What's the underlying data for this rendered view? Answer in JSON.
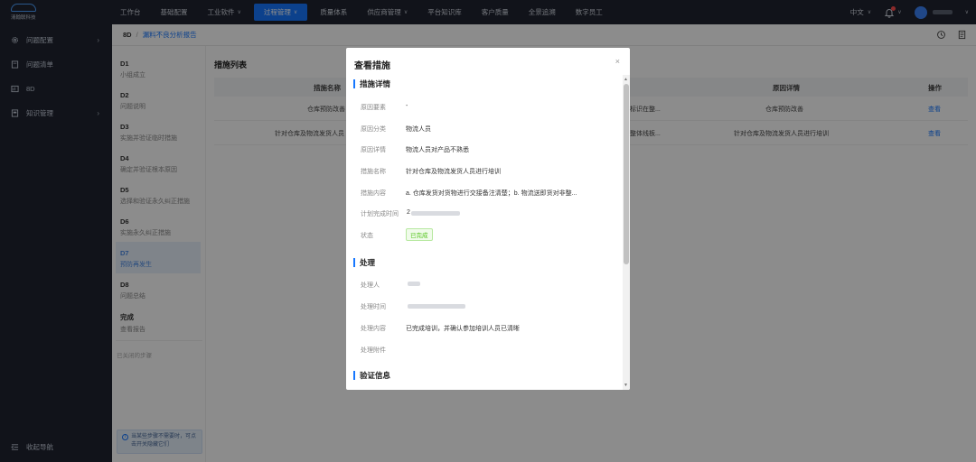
{
  "brand": {
    "name": "清翰联科技"
  },
  "topnav": {
    "items": [
      {
        "label": "工作台"
      },
      {
        "label": "基础配置"
      },
      {
        "label": "工业软件",
        "chevron": true
      },
      {
        "label": "过程管理",
        "chevron": true,
        "active": true
      },
      {
        "label": "质量体系"
      },
      {
        "label": "供应商管理",
        "chevron": true
      },
      {
        "label": "平台知识库"
      },
      {
        "label": "客户质量"
      },
      {
        "label": "全景追溯"
      },
      {
        "label": "数字员工"
      }
    ],
    "language": "中文"
  },
  "sidebar": {
    "items": [
      {
        "label": "问题配置",
        "icon": "gear-icon",
        "expandable": true
      },
      {
        "label": "问题清单",
        "icon": "list-icon",
        "expandable": false
      },
      {
        "label": "8D",
        "icon": "report-icon",
        "expandable": false
      },
      {
        "label": "知识管理",
        "icon": "book-icon",
        "expandable": true
      }
    ],
    "collapse_label": "收起导航"
  },
  "breadcrumb": {
    "root": "8D",
    "separator": "/",
    "current": "漏料不良分析报告"
  },
  "steps": {
    "items": [
      {
        "code": "D1",
        "desc": "小组成立"
      },
      {
        "code": "D2",
        "desc": "问题说明"
      },
      {
        "code": "D3",
        "desc": "实施并验证临时措施"
      },
      {
        "code": "D4",
        "desc": "确定并验证根本原因"
      },
      {
        "code": "D5",
        "desc": "选择和验证永久纠正措施"
      },
      {
        "code": "D6",
        "desc": "实施永久纠正措施"
      },
      {
        "code": "D7",
        "desc": "预防再发生",
        "active": true
      },
      {
        "code": "D8",
        "desc": "问题总结"
      },
      {
        "code": "完成",
        "desc": "查看报告"
      }
    ],
    "closed_label": "已关闭的步骤",
    "tip": "当某些步骤不需要时，可点击开关隐藏它们"
  },
  "measures": {
    "title": "措施列表",
    "columns": {
      "name": "措施名称",
      "reason": "原因详情",
      "action": "操作"
    },
    "rows": [
      {
        "name": "仓库预防改善",
        "mid": "标识在整...",
        "reason": "仓库预防改善",
        "action": "查看"
      },
      {
        "name": "针对仓库及物流发货人员",
        "mid": "整体线板...",
        "reason": "针对仓库及物流发货人员进行培训",
        "action": "查看"
      }
    ]
  },
  "modal": {
    "title": "查看措施",
    "close": "×",
    "detail": {
      "title": "措施详情",
      "fields": [
        {
          "label": "原因要素",
          "value": "-"
        },
        {
          "label": "原因分类",
          "value": "物流人员"
        },
        {
          "label": "原因详情",
          "value": "物流人员对产品不熟悉"
        },
        {
          "label": "措施名称",
          "value": "针对仓库及物流发货人员进行培训"
        },
        {
          "label": "措施内容",
          "value": "a. 仓库发货对货物进行交接备注清楚；b. 物流送即货对非整..."
        },
        {
          "label": "计划完成时间",
          "value": "2"
        },
        {
          "label": "状态",
          "value": "已完成"
        }
      ]
    },
    "handle": {
      "title": "处理",
      "fields": [
        {
          "label": "处理人",
          "value": ""
        },
        {
          "label": "处理时间",
          "value": ""
        },
        {
          "label": "处理内容",
          "value": "已完成培训，并确认参加培训人员已清晰"
        },
        {
          "label": "处理附件",
          "value": ""
        }
      ]
    },
    "verify": {
      "title": "验证信息"
    }
  }
}
